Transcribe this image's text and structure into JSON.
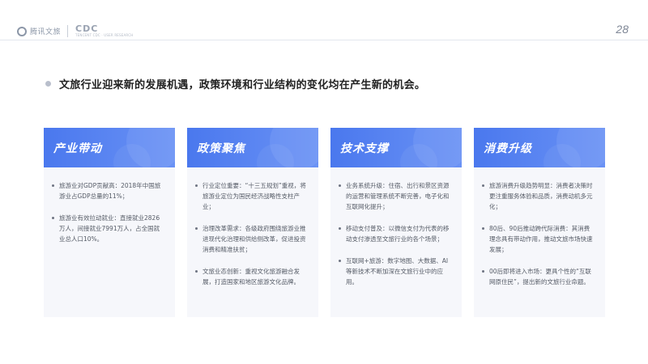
{
  "header": {
    "logo1_text": "腾讯文旅",
    "logo2_text": "CDC",
    "logo2_sub": "TENCENT CDC · USER RESEARCH",
    "page_number": "28"
  },
  "headline": "文旅行业迎来新的发展机遇，政策环境和行业结构的变化均在产生新的机会。",
  "cards": [
    {
      "title": "产业带动",
      "items": [
        "旅游业对GDP贡献高：2018年中国旅游业占GDP总量的11%；",
        "旅游业有效拉动就业：直接就业2826万人，间接就业7991万人，占全国就业总人口10%。"
      ]
    },
    {
      "title": "政策聚焦",
      "items": [
        "行业定位重要：“十三五规划”重视，将旅游业定位为国民经济战略性支柱产业；",
        "治理改革需求：各级政府围绕旅游业推进现代化治理和供给侧改革，促进投资消费和精准扶贫；",
        "文旅业态创新：重视文化旅游融合发展，打造国家和地区旅游文化品牌。"
      ]
    },
    {
      "title": "技术支撑",
      "items": [
        "业务系统升级：住宿、出行和景区资源的运营和管理系统不断完善，电子化和互联网化提升；",
        "移动支付普及：以微信支付为代表的移动支付渗透至文旅行业的各个场景；",
        "互联网+旅游：数字地图、大数据、AI 等新技术不断加深在文旅行业中的应用。"
      ]
    },
    {
      "title": "消费升级",
      "items": [
        "旅游消费升级趋势明显：消费者决策时更注重服务体验和品质，消费动机多元化；",
        "80后、90后推动跨代际消费：其消费理念具有带动作用，推动文旅市场快速发展；",
        "00后即将进入市场：更具个性的“互联网原住民”，提出新的文旅行业命题。"
      ]
    }
  ]
}
